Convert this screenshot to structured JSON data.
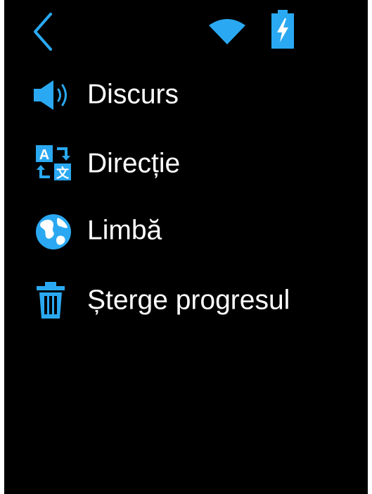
{
  "status_bar": {
    "accent_color": "#2aa9f2",
    "icons": [
      "back-chevron-icon",
      "wifi-icon",
      "battery-charging-icon"
    ]
  },
  "menu": {
    "items": [
      {
        "name": "speech",
        "label": "Discurs",
        "icon": "speaker-icon"
      },
      {
        "name": "direction",
        "label": "Direcție",
        "icon": "translate-icon"
      },
      {
        "name": "language",
        "label": "Limbă",
        "icon": "globe-icon"
      },
      {
        "name": "clear-progress",
        "label": "Șterge progresul",
        "icon": "trash-icon"
      }
    ]
  },
  "colors": {
    "background": "#000000",
    "text": "#ffffff",
    "icon": "#2aa9f2"
  }
}
